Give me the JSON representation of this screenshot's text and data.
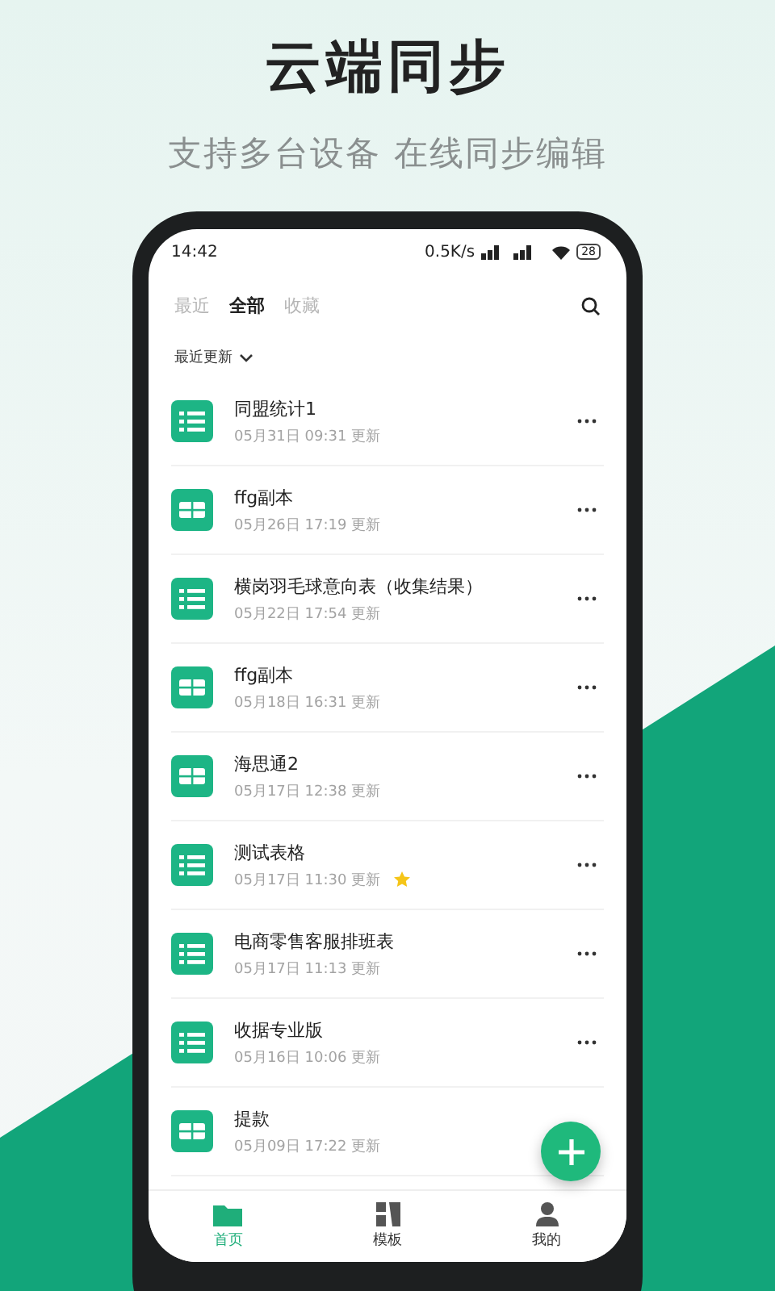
{
  "headline": "云端同步",
  "subheadline": "支持多台设备 在线同步编辑",
  "status_bar": {
    "time": "14:42",
    "speed": "0.5K/s",
    "battery": "28"
  },
  "tabs": [
    {
      "label": "最近",
      "selected": false
    },
    {
      "label": "全部",
      "selected": true
    },
    {
      "label": "收藏",
      "selected": false
    }
  ],
  "sort": {
    "label": "最近更新"
  },
  "files": [
    {
      "kind": "list",
      "name": "同盟统计1",
      "updated": "05月31日 09:31 更新",
      "starred": false
    },
    {
      "kind": "grid",
      "name": "ffg副本",
      "updated": "05月26日 17:19 更新",
      "starred": false
    },
    {
      "kind": "list",
      "name": "横岗羽毛球意向表（收集结果）",
      "updated": "05月22日 17:54 更新",
      "starred": false
    },
    {
      "kind": "grid",
      "name": "ffg副本",
      "updated": "05月18日 16:31 更新",
      "starred": false
    },
    {
      "kind": "grid",
      "name": "海思通2",
      "updated": "05月17日 12:38 更新",
      "starred": false
    },
    {
      "kind": "list",
      "name": "测试表格",
      "updated": "05月17日 11:30 更新",
      "starred": true
    },
    {
      "kind": "list",
      "name": "电商零售客服排班表",
      "updated": "05月17日 11:13 更新",
      "starred": false
    },
    {
      "kind": "list",
      "name": "收据专业版",
      "updated": "05月16日 10:06 更新",
      "starred": false
    },
    {
      "kind": "grid",
      "name": "提款",
      "updated": "05月09日 17:22 更新",
      "starred": false
    }
  ],
  "nav": [
    {
      "label": "首页",
      "selected": true
    },
    {
      "label": "模板",
      "selected": false
    },
    {
      "label": "我的",
      "selected": false
    }
  ]
}
